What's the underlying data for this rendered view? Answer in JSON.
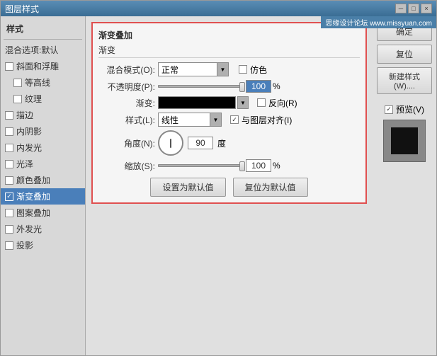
{
  "window": {
    "title": "图层样式",
    "watermark": "思缘设计论坛 www.missyuan.com",
    "close_btn": "×",
    "min_btn": "─",
    "max_btn": "□"
  },
  "sidebar": {
    "title": "样式",
    "items": [
      {
        "label": "混合选项:默认",
        "checked": false,
        "active": false
      },
      {
        "label": "斜面和浮雕",
        "checked": false,
        "active": false
      },
      {
        "label": "等高线",
        "checked": false,
        "active": false,
        "indent": true
      },
      {
        "label": "纹理",
        "checked": false,
        "active": false,
        "indent": true
      },
      {
        "label": "描边",
        "checked": false,
        "active": false
      },
      {
        "label": "内阴影",
        "checked": false,
        "active": false
      },
      {
        "label": "内发光",
        "checked": false,
        "active": false
      },
      {
        "label": "光泽",
        "checked": false,
        "active": false
      },
      {
        "label": "颜色叠加",
        "checked": false,
        "active": false
      },
      {
        "label": "渐变叠加",
        "checked": true,
        "active": true
      },
      {
        "label": "图案叠加",
        "checked": false,
        "active": false
      },
      {
        "label": "外发光",
        "checked": false,
        "active": false
      },
      {
        "label": "投影",
        "checked": false,
        "active": false
      }
    ]
  },
  "main": {
    "section_title": "渐变叠加",
    "subsection_title": "渐变",
    "blend_mode_label": "混合模式(O):",
    "blend_mode_value": "正常",
    "opacity_label": "不透明度(P):",
    "opacity_value": "100",
    "opacity_unit": "%",
    "gradient_label": "渐变:",
    "reverse_label": "反向(R)",
    "style_label": "样式(L):",
    "style_value": "线性",
    "align_label": "与图层对齐(I)",
    "angle_label": "角度(N):",
    "angle_value": "90",
    "angle_unit": "度",
    "scale_label": "缩放(S):",
    "scale_value": "100",
    "scale_unit": "%",
    "simulate_label": "仿色",
    "set_default_btn": "设置为默认值",
    "reset_default_btn": "复位为默认值"
  },
  "right_panel": {
    "ok_btn": "确定",
    "reset_btn": "复位",
    "new_style_btn": "新建样式(W)....",
    "preview_label": "预览(V)"
  }
}
